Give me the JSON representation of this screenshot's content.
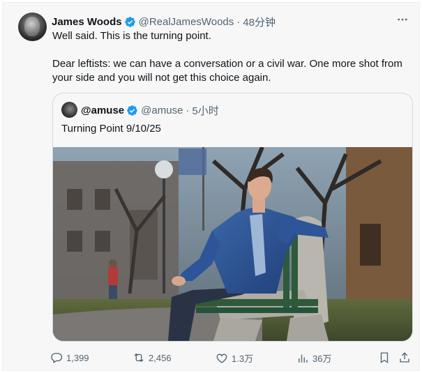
{
  "post": {
    "author_name": "James Woods",
    "handle": "@RealJamesWoods",
    "separator": "·",
    "time": "48分钟",
    "paragraphs": [
      "Well said. This is the turning point.",
      "Dear leftists: we can have a conversation or a civil war. One more shot from your side and you will not get this choice again."
    ]
  },
  "quote": {
    "author_name": "@amuse",
    "handle": "@amuse",
    "separator": "·",
    "time": "5小时",
    "text": "Turning Point 9/10/25"
  },
  "actions": {
    "replies": "1,399",
    "reposts": "2,456",
    "likes": "1.3万",
    "views": "36万"
  },
  "colors": {
    "verified": "#1d9bf0",
    "secondary_text": "#536471",
    "card_background": "#f7f7f7",
    "border": "#cfd9de"
  },
  "icons": [
    "more-icon",
    "verified-badge-icon",
    "reply-icon",
    "repost-icon",
    "like-icon",
    "views-icon",
    "bookmark-icon",
    "share-icon"
  ]
}
